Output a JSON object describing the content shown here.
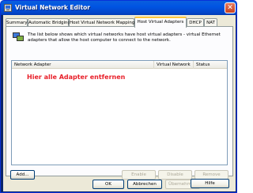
{
  "window": {
    "title": "Virtual Network Editor",
    "close": "✕"
  },
  "tabs": [
    {
      "label": "Summary"
    },
    {
      "label": "Automatic Bridging"
    },
    {
      "label": "Host Virtual Network Mapping"
    },
    {
      "label": "Host Virtual Adapters"
    },
    {
      "label": "DHCP"
    },
    {
      "label": "NAT"
    }
  ],
  "active_tab": "Host Virtual Adapters",
  "panel": {
    "description": "The list below shows which virtual networks have host virtual adapters - virtual Ethernet adapters that allow the host computer to connect to the network.",
    "icon": "network-adapter-icon"
  },
  "list": {
    "columns": [
      "Network Adapter",
      "Virtual Network",
      "Status"
    ],
    "rows": []
  },
  "annotation": {
    "text": "Hier alle Adapter entfernen",
    "color": "#e8202a"
  },
  "panel_buttons": {
    "add": "Add...",
    "enable": "Enable",
    "disable": "Disable",
    "remove": "Remove"
  },
  "dialog_buttons": {
    "ok": "OK",
    "cancel": "Abbrechen",
    "apply": "Übernehmen",
    "help": "Hilfe"
  }
}
